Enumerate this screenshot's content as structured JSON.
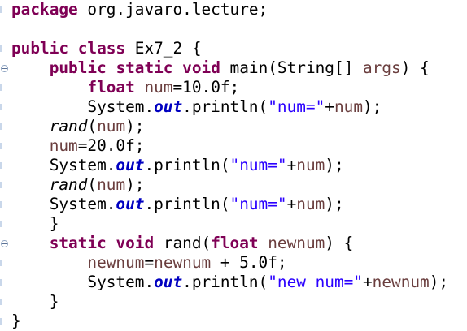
{
  "editor": {
    "lines": [
      [
        {
          "t": "kw",
          "v": "package"
        },
        {
          "t": "plain",
          "v": " org.javaro.lecture;"
        }
      ],
      [],
      [
        {
          "t": "kw",
          "v": "public"
        },
        {
          "t": "plain",
          "v": " "
        },
        {
          "t": "kw",
          "v": "class"
        },
        {
          "t": "plain",
          "v": " Ex7_2 {"
        }
      ],
      [
        {
          "t": "plain",
          "v": "    "
        },
        {
          "t": "kw",
          "v": "public"
        },
        {
          "t": "plain",
          "v": " "
        },
        {
          "t": "kw",
          "v": "static"
        },
        {
          "t": "plain",
          "v": " "
        },
        {
          "t": "kw",
          "v": "void"
        },
        {
          "t": "plain",
          "v": " main(String[] "
        },
        {
          "t": "var",
          "v": "args"
        },
        {
          "t": "plain",
          "v": ") {"
        }
      ],
      [
        {
          "t": "plain",
          "v": "        "
        },
        {
          "t": "kw",
          "v": "float"
        },
        {
          "t": "plain",
          "v": " "
        },
        {
          "t": "var",
          "v": "num"
        },
        {
          "t": "plain",
          "v": "=10.0f;"
        }
      ],
      [
        {
          "t": "plain",
          "v": "        System."
        },
        {
          "t": "fld",
          "v": "out"
        },
        {
          "t": "plain",
          "v": ".println("
        },
        {
          "t": "str",
          "v": "\"num=\""
        },
        {
          "t": "plain",
          "v": "+"
        },
        {
          "t": "var",
          "v": "num"
        },
        {
          "t": "plain",
          "v": ");"
        }
      ],
      [
        {
          "t": "plain",
          "v": "    "
        },
        {
          "t": "st",
          "v": "rand"
        },
        {
          "t": "plain",
          "v": "("
        },
        {
          "t": "var",
          "v": "num"
        },
        {
          "t": "plain",
          "v": ");"
        }
      ],
      [
        {
          "t": "plain",
          "v": "    "
        },
        {
          "t": "var",
          "v": "num"
        },
        {
          "t": "plain",
          "v": "=20.0f;"
        }
      ],
      [
        {
          "t": "plain",
          "v": "    System."
        },
        {
          "t": "fld",
          "v": "out"
        },
        {
          "t": "plain",
          "v": ".println("
        },
        {
          "t": "str",
          "v": "\"num=\""
        },
        {
          "t": "plain",
          "v": "+"
        },
        {
          "t": "var",
          "v": "num"
        },
        {
          "t": "plain",
          "v": ");"
        }
      ],
      [
        {
          "t": "plain",
          "v": "    "
        },
        {
          "t": "st",
          "v": "rand"
        },
        {
          "t": "plain",
          "v": "("
        },
        {
          "t": "var",
          "v": "num"
        },
        {
          "t": "plain",
          "v": ");"
        }
      ],
      [
        {
          "t": "plain",
          "v": "    System."
        },
        {
          "t": "fld",
          "v": "out"
        },
        {
          "t": "plain",
          "v": ".println("
        },
        {
          "t": "str",
          "v": "\"num=\""
        },
        {
          "t": "plain",
          "v": "+"
        },
        {
          "t": "var",
          "v": "num"
        },
        {
          "t": "plain",
          "v": ");"
        }
      ],
      [
        {
          "t": "plain",
          "v": "    }"
        }
      ],
      [
        {
          "t": "plain",
          "v": "    "
        },
        {
          "t": "kw",
          "v": "static"
        },
        {
          "t": "plain",
          "v": " "
        },
        {
          "t": "kw",
          "v": "void"
        },
        {
          "t": "plain",
          "v": " rand("
        },
        {
          "t": "kw",
          "v": "float"
        },
        {
          "t": "plain",
          "v": " "
        },
        {
          "t": "var",
          "v": "newnum"
        },
        {
          "t": "plain",
          "v": ") {"
        }
      ],
      [
        {
          "t": "plain",
          "v": "        "
        },
        {
          "t": "var",
          "v": "newnum"
        },
        {
          "t": "plain",
          "v": "="
        },
        {
          "t": "var",
          "v": "newnum"
        },
        {
          "t": "plain",
          "v": " + 5.0f;"
        }
      ],
      [
        {
          "t": "plain",
          "v": "        System."
        },
        {
          "t": "fld",
          "v": "out"
        },
        {
          "t": "plain",
          "v": ".println("
        },
        {
          "t": "str",
          "v": "\"new num=\""
        },
        {
          "t": "plain",
          "v": "+"
        },
        {
          "t": "var",
          "v": "newnum"
        },
        {
          "t": "plain",
          "v": ");"
        }
      ],
      [
        {
          "t": "plain",
          "v": "    }"
        }
      ],
      [
        {
          "t": "plain",
          "v": "}"
        }
      ]
    ]
  },
  "colors": {
    "keyword": "#7f0055",
    "string": "#2a00ff",
    "static_field": "#0000c0",
    "local_variable": "#6a3e3e",
    "default_text": "#000000",
    "background": "#ffffff"
  }
}
